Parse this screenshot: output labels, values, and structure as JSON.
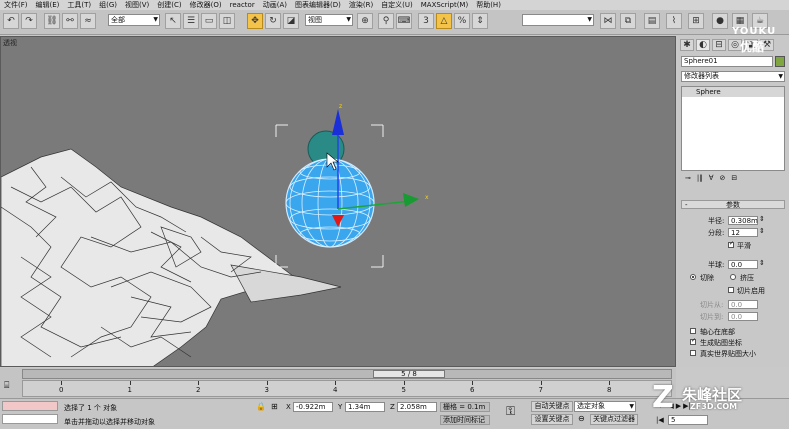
{
  "menu": [
    "文件(F)",
    "编辑(E)",
    "工具(T)",
    "组(G)",
    "视图(V)",
    "创建(C)",
    "修改器(O)",
    "reactor",
    "动画(A)",
    "图表编辑器(D)",
    "渲染(R)",
    "自定义(U)",
    "MAXScript(M)",
    "帮助(H)"
  ],
  "toolbar": {
    "selection_filter": "全部",
    "ref_coord": "视图",
    "named_sel": ""
  },
  "viewport": {
    "label": "透视",
    "axis_x": "x",
    "axis_z": "z"
  },
  "cmd": {
    "object_name": "Sphere01",
    "color_swatch": "#7fa640",
    "modifier_list": "修改器列表",
    "stack_item": "Sphere",
    "rollout": "参数",
    "radius_label": "半径:",
    "radius": "0.308m",
    "segments_label": "分段:",
    "segments": "12",
    "smooth": "平滑",
    "hemisphere_label": "半球:",
    "hemisphere": "0.0",
    "chop": "切除",
    "squash": "挤压",
    "slice_on": "切片启用",
    "slice_from_label": "切片从:",
    "slice_from": "0.0",
    "slice_to_label": "切片到:",
    "slice_to": "0.0",
    "base_to_pivot": "轴心在底部",
    "gen_map": "生成贴图坐标",
    "real_world": "真实世界贴图大小"
  },
  "timeline": {
    "frame": "5 / 8",
    "ticks": [
      "0",
      "1",
      "2",
      "3",
      "4",
      "5",
      "6",
      "7",
      "8"
    ]
  },
  "status": {
    "selected": "选择了 1 个 对象",
    "prompt": "单击并拖动以选择并移动对象",
    "x": "-0.922m",
    "y": "1.34m",
    "z": "2.058m",
    "grid": "栅格 = 0.1m",
    "add_time_tag": "添加时间标记",
    "auto_key": "自动关键点",
    "set_key": "设置关键点",
    "selected_obj": "选定对象",
    "key_filters": "关键点过滤器",
    "frame_field": "5"
  },
  "watermarks": {
    "youku": "YOUKU",
    "youku_cn": "优酷",
    "site": "朱峰社区",
    "url": "ZF3D.COM"
  }
}
